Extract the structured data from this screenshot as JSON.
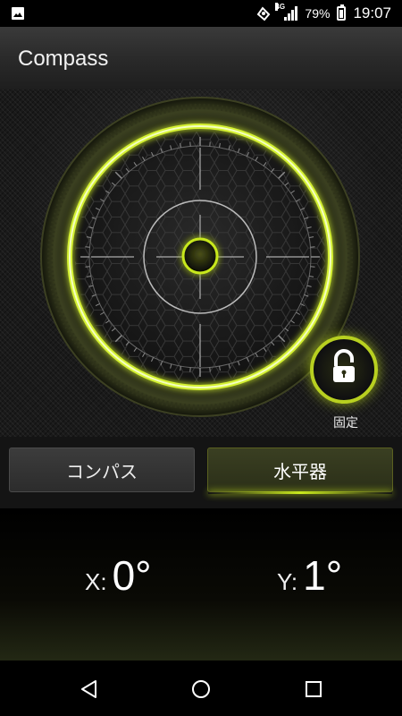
{
  "status_bar": {
    "battery": "79%",
    "time": "19:07",
    "network": "4G",
    "icons": [
      "image-notification-icon",
      "nfc-icon",
      "signal-icon",
      "battery-icon"
    ]
  },
  "app_bar": {
    "title": "Compass"
  },
  "level": {
    "lock_label": "固定",
    "lock_icon": "unlocked-padlock-icon"
  },
  "tabs": [
    {
      "label": "コンパス",
      "active": false
    },
    {
      "label": "水平器",
      "active": true
    }
  ],
  "readout": {
    "x_label": "X:",
    "x_value": "0°",
    "y_label": "Y:",
    "y_value": "1°"
  },
  "nav": [
    "back-icon",
    "home-icon",
    "recents-icon"
  ],
  "colors": {
    "accent": "#c8e81e",
    "background": "#000000",
    "tab_active": "#2b2f18"
  }
}
